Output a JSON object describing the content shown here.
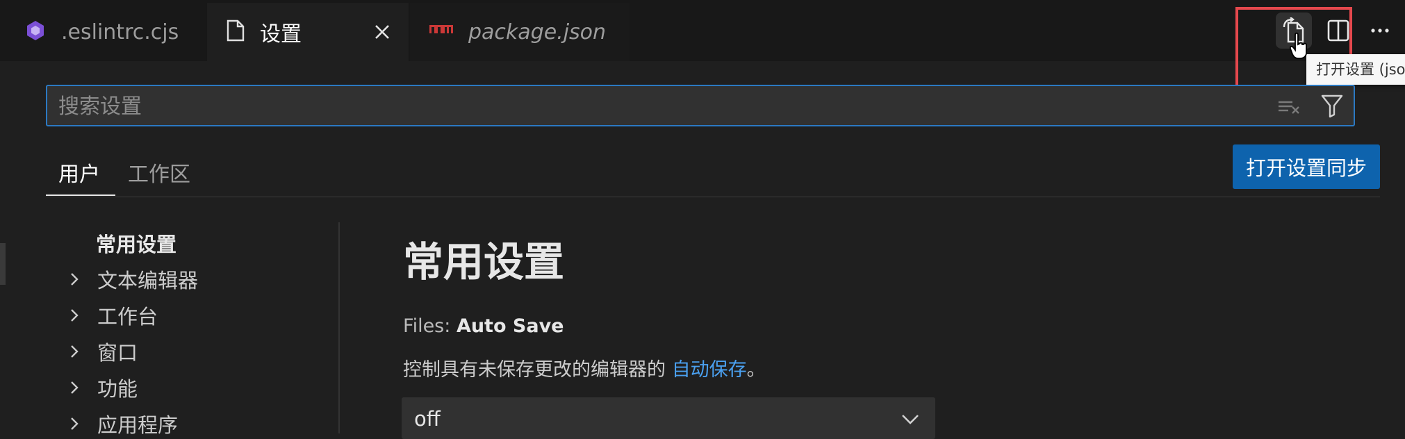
{
  "tabs": [
    {
      "label": ".eslintrc.cjs",
      "icon": "eslint-icon"
    },
    {
      "label": "设置",
      "icon": "file-icon",
      "active": true
    },
    {
      "label": "package.json",
      "icon": "npm-icon"
    }
  ],
  "editor_actions": {
    "open_settings_json_icon": "open-settings-json-icon",
    "split_icon": "split-editor-icon",
    "more_icon": "more-icon",
    "tooltip": "打开设置 (json"
  },
  "search": {
    "placeholder": "搜索设置",
    "value": ""
  },
  "scopes": [
    "用户",
    "工作区"
  ],
  "sync_button": "打开设置同步",
  "toc": {
    "heading": "常用设置",
    "items": [
      "文本编辑器",
      "工作台",
      "窗口",
      "功能",
      "应用程序"
    ]
  },
  "content": {
    "title": "常用设置",
    "setting": {
      "category": "Files: ",
      "name": "Auto Save",
      "description_prefix": "控制具有未保存更改的编辑器的 ",
      "description_link": "自动保存",
      "description_suffix": "。",
      "value": "off"
    }
  },
  "colors": {
    "accent": "#0e63ad",
    "highlight": "#e5484d",
    "link": "#4aa0f0",
    "background": "#1f1f1f"
  }
}
